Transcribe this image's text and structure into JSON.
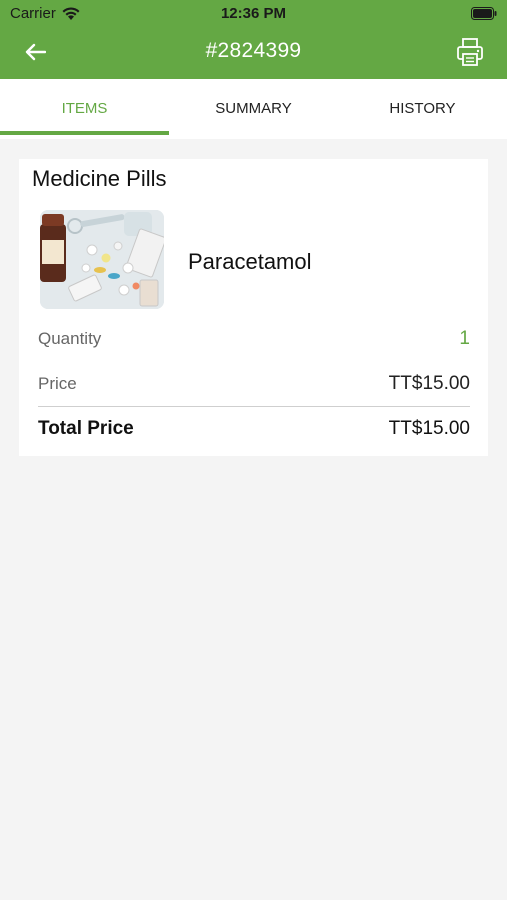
{
  "status_bar": {
    "carrier": "Carrier",
    "time": "12:36 PM"
  },
  "nav": {
    "title": "#2824399",
    "back_icon": "arrow-left-icon",
    "print_icon": "printer-icon"
  },
  "tabs": [
    {
      "label": "ITEMS",
      "active": true
    },
    {
      "label": "SUMMARY",
      "active": false
    },
    {
      "label": "HISTORY",
      "active": false
    }
  ],
  "item_card": {
    "category": "Medicine Pills",
    "product_name": "Paracetamol",
    "quantity_label": "Quantity",
    "quantity_value": "1",
    "price_label": "Price",
    "price_value": "TT$15.00",
    "total_label": "Total Price",
    "total_value": "TT$15.00"
  },
  "colors": {
    "brand_green": "#64a844",
    "background": "#f4f4f4"
  }
}
